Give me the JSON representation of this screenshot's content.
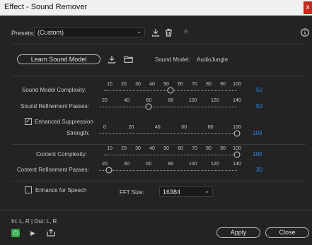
{
  "window": {
    "title": "Effect - Sound Remover",
    "close_glyph": "x"
  },
  "presets": {
    "label": "Presets:",
    "value": "(Custom)"
  },
  "icons": {
    "download": "download-icon",
    "trash": "trash-icon",
    "star": "star-icon",
    "info": "info-icon",
    "folder": "folder-icon",
    "power": "power-icon",
    "play": "play-icon",
    "export": "export-icon",
    "chevron": "chevron-down-icon"
  },
  "learn": {
    "button_label": "Learn Sound Model",
    "model_label": "Sound Model:",
    "model_value": "AudioJungle"
  },
  "sliders": {
    "complexity": {
      "label": "Sound Model Complexity:",
      "ticks": [
        "10",
        "20",
        "30",
        "40",
        "50",
        "60",
        "70",
        "80",
        "90",
        "100"
      ],
      "value": "50",
      "fraction": 0.5
    },
    "refinement": {
      "label": "Sound Refinement Passes:",
      "ticks": [
        "20",
        "40",
        "60",
        "80",
        "100",
        "120",
        "140"
      ],
      "value": "50",
      "fraction": 0.357
    },
    "strength": {
      "label": "Strength:",
      "ticks": [
        "0",
        "20",
        "40",
        "60",
        "80",
        "100"
      ],
      "value": "100",
      "fraction": 1.0
    },
    "content_complexity": {
      "label": "Content Complexity:",
      "ticks": [
        "10",
        "20",
        "30",
        "40",
        "50",
        "60",
        "70",
        "80",
        "90",
        "100"
      ],
      "value": "100",
      "fraction": 1.0
    },
    "content_refinement": {
      "label": "Content Refinement Passes:",
      "ticks": [
        "20",
        "40",
        "60",
        "80",
        "100",
        "120",
        "140"
      ],
      "value": "30",
      "fraction": 0.071
    }
  },
  "enhanced_suppression": {
    "label": "Enhanced Suppression",
    "checked": true
  },
  "enhance_speech": {
    "label": "Enhance for Speech",
    "checked": false
  },
  "fft": {
    "label": "FFT Size:",
    "value": "16384"
  },
  "io": {
    "text": "In: L, R | Out: L, R"
  },
  "footer": {
    "apply_label": "Apply",
    "close_label": "Close"
  },
  "colors": {
    "accent": "#2d8ceb",
    "power": "#2eaa4a",
    "close": "#c42b1c"
  }
}
